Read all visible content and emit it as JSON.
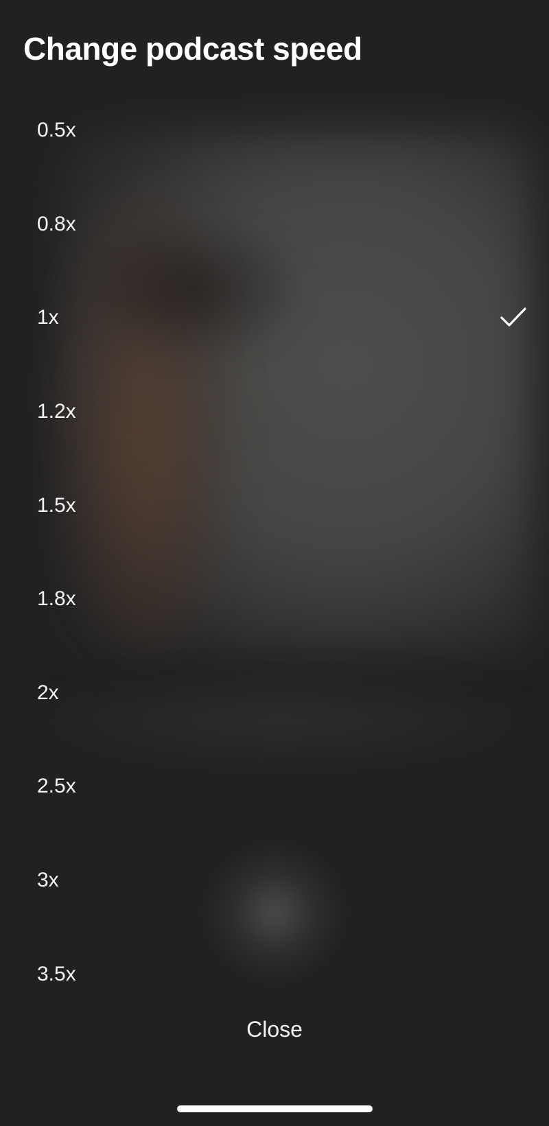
{
  "sheet": {
    "title": "Change podcast speed",
    "options": [
      {
        "label": "0.5x",
        "selected": false
      },
      {
        "label": "0.8x",
        "selected": false
      },
      {
        "label": "1x",
        "selected": true
      },
      {
        "label": "1.2x",
        "selected": false
      },
      {
        "label": "1.5x",
        "selected": false
      },
      {
        "label": "1.8x",
        "selected": false
      },
      {
        "label": "2x",
        "selected": false
      },
      {
        "label": "2.5x",
        "selected": false
      },
      {
        "label": "3x",
        "selected": false
      },
      {
        "label": "3.5x",
        "selected": false
      }
    ],
    "selected_icon": "checkmark-icon",
    "close_label": "Close"
  },
  "colors": {
    "background": "#222122",
    "text": "#ffffff",
    "home_indicator": "#ffffff"
  }
}
